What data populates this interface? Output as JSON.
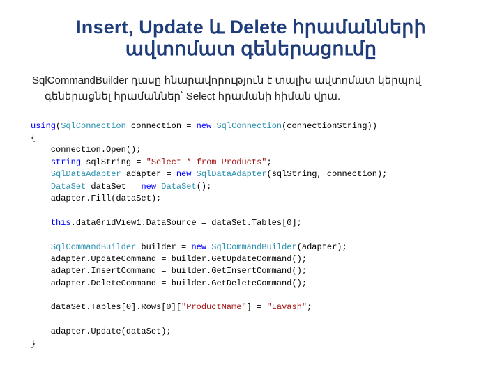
{
  "title": "Insert, Update և Delete հրամանների ավտոմատ գեներացումը",
  "subtitle_line1": "SqlCommandBuilder դասը հնարավորություն է տալիս ավտոմատ կերպով",
  "subtitle_line2": "գեներացնել հրամաններ՝ Select հրամանի հիման վրա.",
  "code": {
    "kw_using": "using",
    "kw_new": "new",
    "kw_string": "string",
    "kw_this": "this",
    "t_SqlConnection": "SqlConnection",
    "t_SqlDataAdapter": "SqlDataAdapter",
    "t_DataSet": "DataSet",
    "t_SqlCommandBuilder": "SqlCommandBuilder",
    "s_select": "\"Select * from Products\"",
    "s_productName": "\"ProductName\"",
    "s_lavash": "\"Lavash\"",
    "l1_a": "(",
    "l1_b": " connection = ",
    "l1_c": "(connectionString))",
    "l2": "{",
    "l3": "    connection.Open();",
    "l4_a": "    ",
    "l4_b": " sqlString = ",
    "l4_c": ";",
    "l5_a": "    ",
    "l5_b": " adapter = ",
    "l5_c": "(sqlString, connection);",
    "l6_a": "    ",
    "l6_b": " dataSet = ",
    "l6_c": "();",
    "l7": "    adapter.Fill(dataSet);",
    "l8_a": "    ",
    "l8_b": ".dataGridView1.DataSource = dataSet.Tables[0];",
    "l9_a": "    ",
    "l9_b": " builder = ",
    "l9_c": "(adapter);",
    "l10": "    adapter.UpdateCommand = builder.GetUpdateCommand();",
    "l11": "    adapter.InsertCommand = builder.GetInsertCommand();",
    "l12": "    adapter.DeleteCommand = builder.GetDeleteCommand();",
    "l13_a": "    dataSet.Tables[0].Rows[0][",
    "l13_b": "] = ",
    "l13_c": ";",
    "l14": "    adapter.Update(dataSet);",
    "l15": "}"
  }
}
